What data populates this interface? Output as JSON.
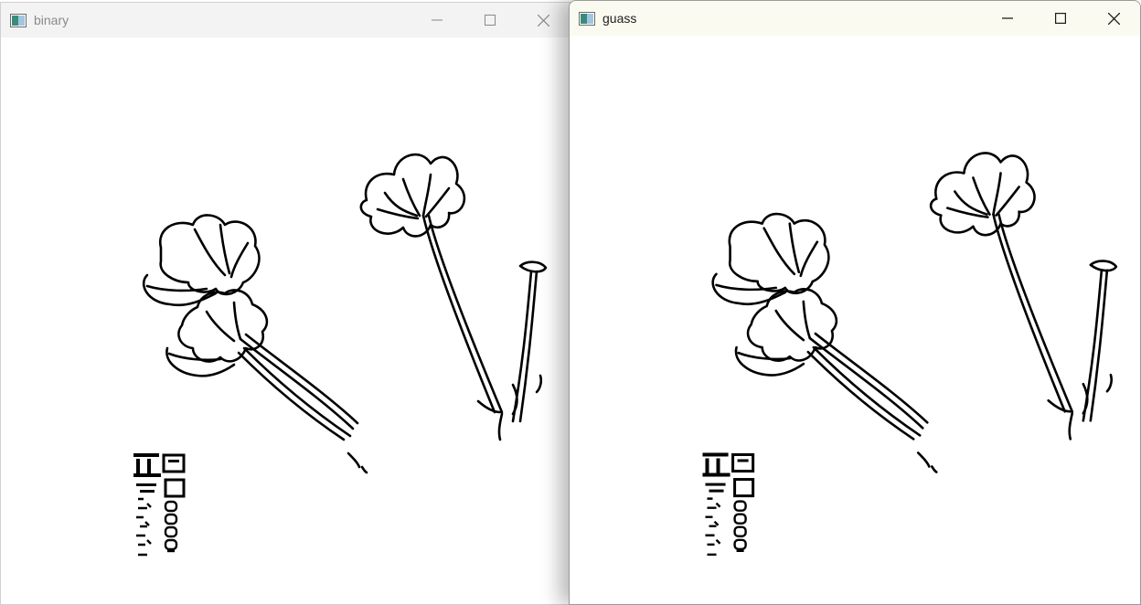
{
  "windows": [
    {
      "id": "binary",
      "title": "binary",
      "active": false,
      "image_description_label": "binary"
    },
    {
      "id": "guass",
      "title": "guass",
      "active": true
    }
  ],
  "controls": {
    "minimize_icon": "minimize-icon",
    "maximize_icon": "maximize-icon",
    "close_icon": "close-icon"
  },
  "colors": {
    "ink": "#000000",
    "background": "#ffffff",
    "inactive_title": "#8a8a8a",
    "active_title": "#202020"
  }
}
